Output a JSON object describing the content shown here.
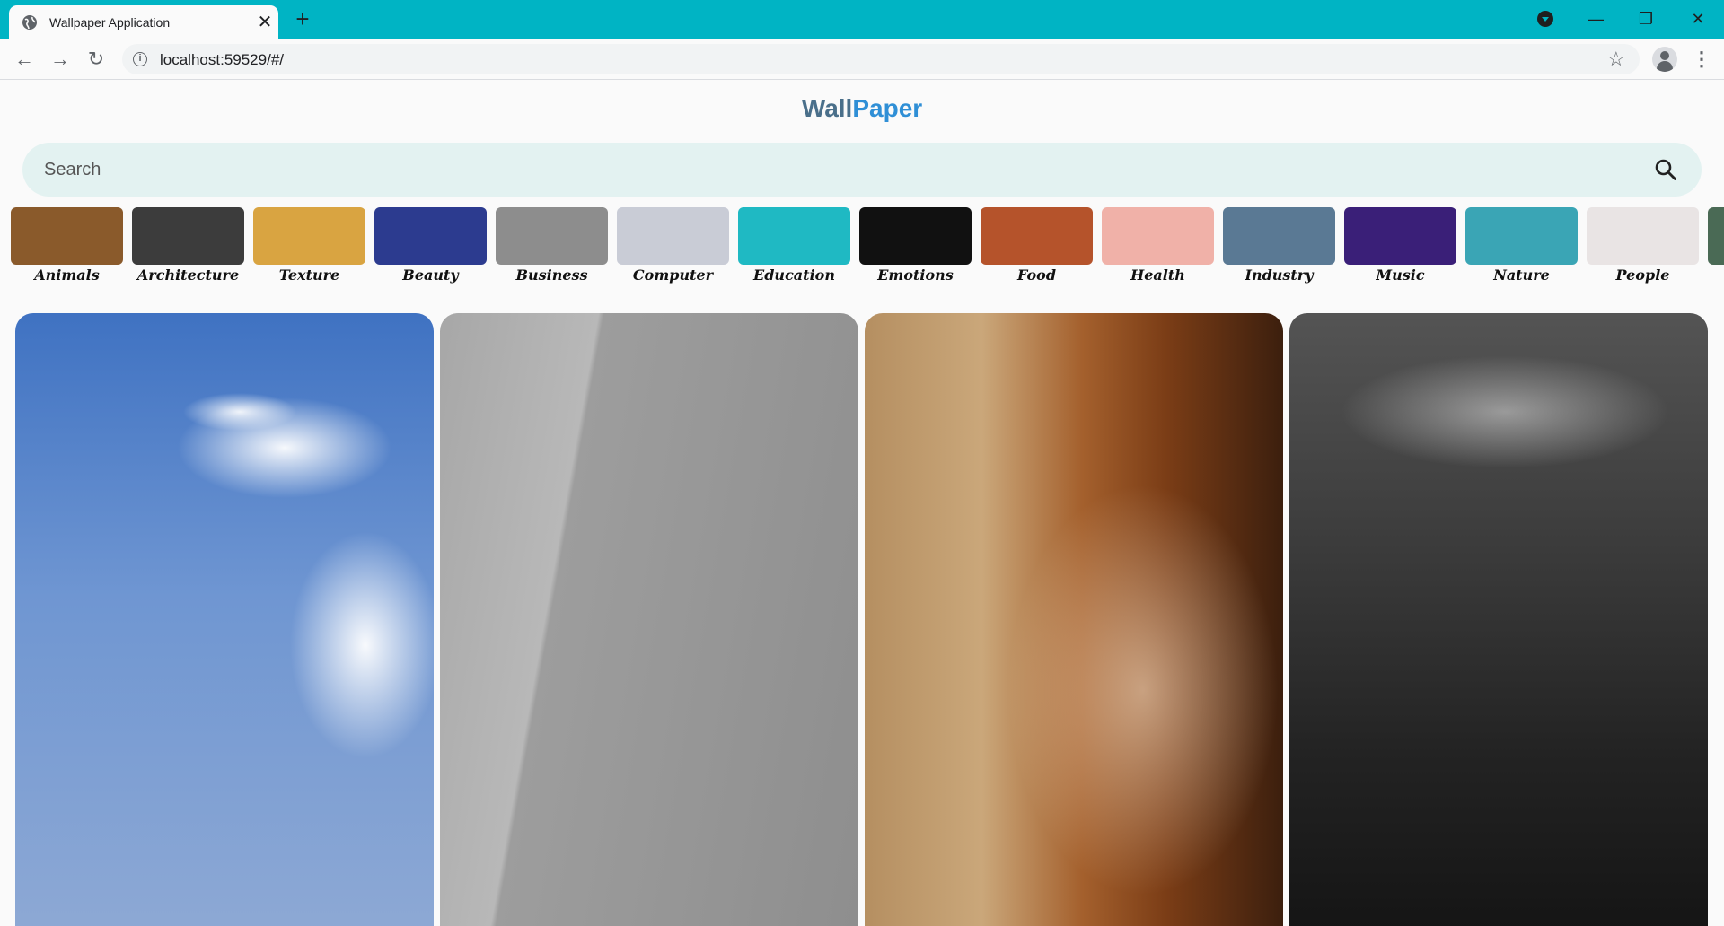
{
  "browser": {
    "tab_title": "Wallpaper Application",
    "tab_close": "✕",
    "new_tab": "+",
    "url": "localhost:59529/#/",
    "controls": {
      "minimize": "—",
      "restore": "❐",
      "close": "✕"
    }
  },
  "app": {
    "brand_part1": "Wall",
    "brand_part2": "Paper",
    "search": {
      "placeholder": "Search"
    },
    "categories": [
      {
        "label": "Animals",
        "color": "#8a5a2b"
      },
      {
        "label": "Architecture",
        "color": "#3c3c3c"
      },
      {
        "label": "Texture",
        "color": "#d9a441"
      },
      {
        "label": "Beauty",
        "color": "#2c3b8f"
      },
      {
        "label": "Business",
        "color": "#8d8d8d"
      },
      {
        "label": "Computer",
        "color": "#c9ccd6"
      },
      {
        "label": "Education",
        "color": "#1fb9c3"
      },
      {
        "label": "Emotions",
        "color": "#111111"
      },
      {
        "label": "Food",
        "color": "#b5532b"
      },
      {
        "label": "Health",
        "color": "#f0b1a8"
      },
      {
        "label": "Industry",
        "color": "#5a7994"
      },
      {
        "label": "Music",
        "color": "#3a1f78"
      },
      {
        "label": "Nature",
        "color": "#3aa5b5"
      },
      {
        "label": "People",
        "color": "#e9e4e4"
      },
      {
        "label": "",
        "color": "#4a6a55"
      }
    ],
    "photos": [
      {
        "name": "photo-woman-sky",
        "style": "p-girl"
      },
      {
        "name": "photo-building",
        "style": "p-building"
      },
      {
        "name": "photo-incense-smoke",
        "style": "p-smoke"
      },
      {
        "name": "photo-dark-sea",
        "style": "p-sea"
      }
    ]
  }
}
